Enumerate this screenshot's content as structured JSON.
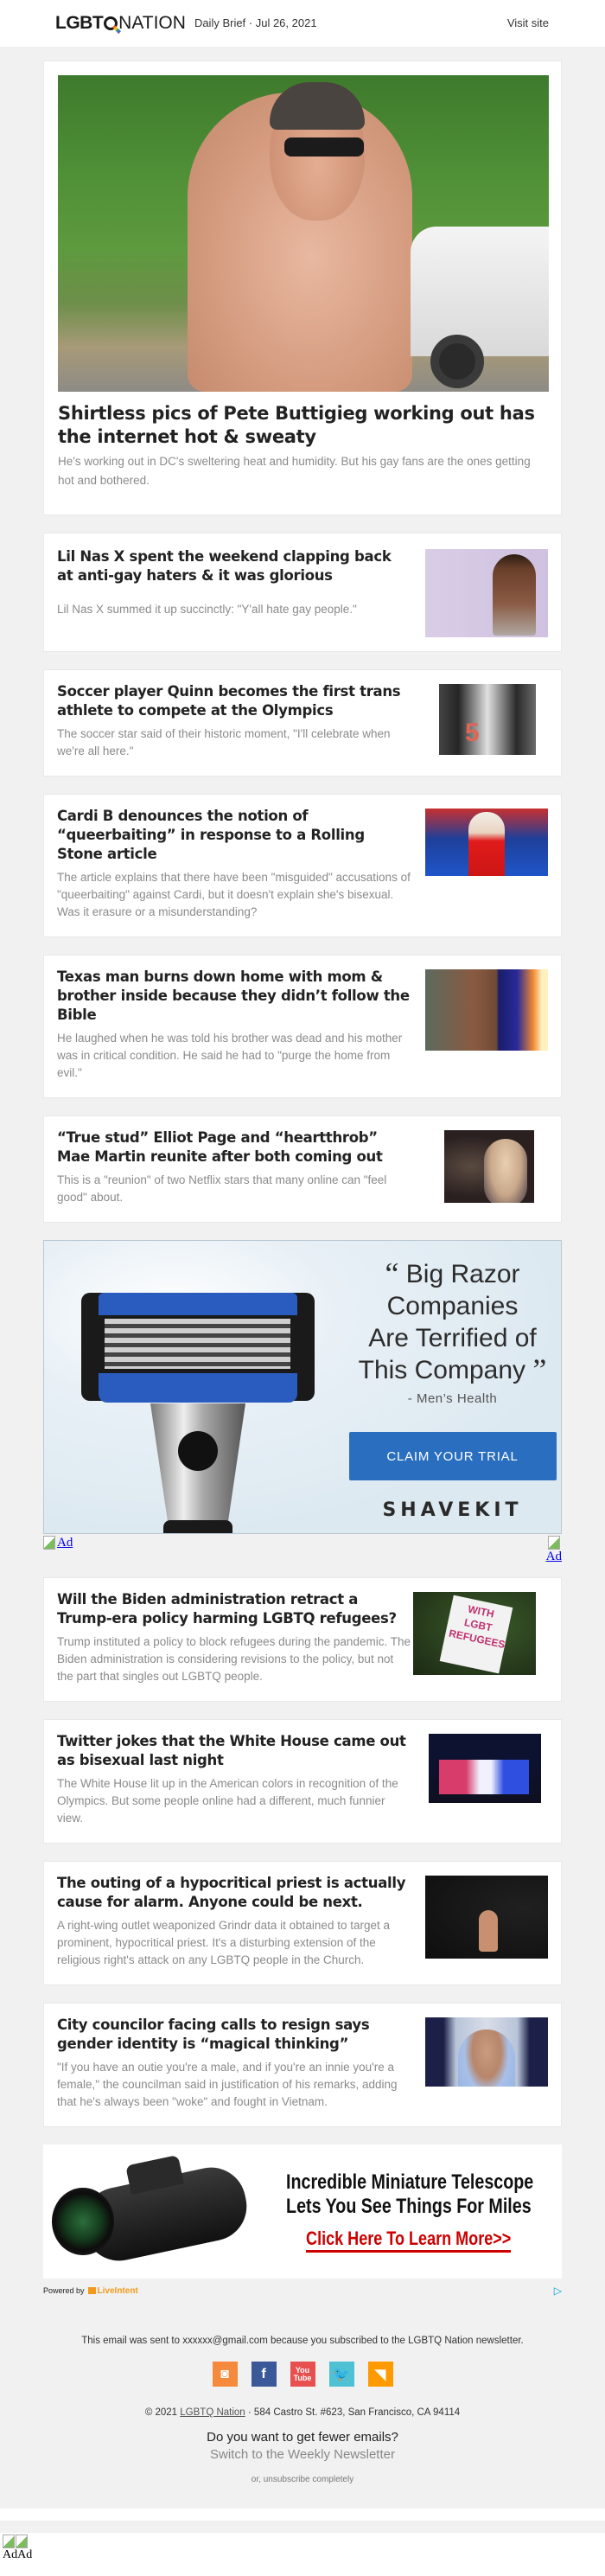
{
  "header": {
    "logo_bold": "LGBT",
    "logo_light": "NATION",
    "brief": "Daily Brief · Jul 26, 2021",
    "visit_site": "Visit site"
  },
  "hero": {
    "image_alt": "Pete Buttigieg shirtless outdoors",
    "title": "Shirtless pics of Pete Buttigieg working out has the internet hot & sweaty",
    "desc": "He's working out in DC's sweltering heat and humidity. But his gay fans are the ones getting hot and bothered."
  },
  "stories": [
    {
      "title": "Lil Nas X spent the weekend clapping back at anti-gay haters & it was glorious",
      "desc": "Lil Nas X summed it up succinctly: \"Y'all hate gay people.\""
    },
    {
      "title": "Soccer player Quinn becomes the first trans athlete to compete at the Olympics",
      "desc": "The soccer star said of their historic moment, \"I'll celebrate when we're all here.\""
    },
    {
      "title": "Cardi B denounces the notion of “queerbaiting” in response to a Rolling Stone article",
      "desc": "The article explains that there have been \"misguided\" accusations of \"queerbaiting\" against Cardi, but it doesn't explain she's bisexual. Was it erasure or a misunderstanding?"
    },
    {
      "title": "Texas man burns down home with mom & brother inside because they didn’t follow the Bible",
      "desc": "He laughed when he was told his brother was dead and his mother was in critical condition. He said he had to \"purge the home from evil.\""
    },
    {
      "title": "“True stud” Elliot Page and “heartthrob” Mae Martin reunite after both coming out",
      "desc": "This is a \"reunion\" of two Netflix stars that many online can \"feel good\" about."
    },
    {
      "title": "Will the Biden administration retract a Trump-era policy harming LGBTQ refugees?",
      "desc": "Trump instituted a policy to block refugees during the pandemic. The Biden administration is considering revisions to the policy, but not the part that singles out LGBTQ people."
    },
    {
      "title": "Twitter jokes that the White House came out as bisexual last night",
      "desc": "The White House lit up in the American colors in recognition of the Olympics. But some people online had a different, much funnier view."
    },
    {
      "title": "The outing of a hypocritical priest is actually cause for alarm. Anyone could be next.",
      "desc": "A right-wing outlet weaponized Grindr data it obtained to target a prominent, hypocritical priest. It's a disturbing extension of the religious right's attack on any LGBTQ people in the Church."
    },
    {
      "title": "City councilor facing calls to resign says gender identity is “magical thinking”",
      "desc": "\"If you have an outie you're a male, and if you're an innie you're a female,\" the councilman said in justification of his remarks, adding that he's always been \"woke\" and fought in Vietnam."
    }
  ],
  "ad_shavekit": {
    "quote_open": "“",
    "quote_line1": "Big Razor",
    "quote_line2": "Companies",
    "quote_line3": "Are Terrified of",
    "quote_line4": "This Company",
    "quote_close": "”",
    "source": "- Men’s Health",
    "cta": "CLAIM YOUR TRIAL",
    "brand": "SHAVEKIT",
    "accent": "#2a6ebf"
  },
  "ad_links": {
    "left": "Ad",
    "right": "Ad"
  },
  "ad_telescope": {
    "line1": "Incredible Miniature Telescope",
    "line2": "Lets You See Things For Miles",
    "cta": "Click Here To Learn More>>",
    "cta_color": "#cc0000"
  },
  "powered": {
    "prefix": "Powered by",
    "brand": "LiveIntent",
    "adchoices_icon": "adchoices-icon"
  },
  "footer": {
    "sent": "This email was sent to xxxxxx@gmail.com because you subscribed to the LGBTQ Nation newsletter.",
    "social": [
      {
        "name": "instagram",
        "glyph": "◙",
        "color": "#f58a3c"
      },
      {
        "name": "facebook",
        "glyph": "f",
        "color": "#3b5998"
      },
      {
        "name": "youtube",
        "glyph": "You Tube",
        "color": "#e85050"
      },
      {
        "name": "twitter",
        "glyph": "🐦",
        "color": "#4ec1d4"
      },
      {
        "name": "rss",
        "glyph": "◥",
        "color": "#ff9a00"
      }
    ],
    "copyright_prefix": "© 2021",
    "copyright_link": "LGBTQ Nation",
    "address": "· 584 Castro St. #623, San Francisco, CA 94114",
    "fewer": "Do you want to get fewer emails?",
    "weekly": "Switch to the Weekly Newsletter",
    "unsubscribe": "or, unsubscribe completely"
  },
  "bottom_ads": {
    "label": "AdAd"
  }
}
